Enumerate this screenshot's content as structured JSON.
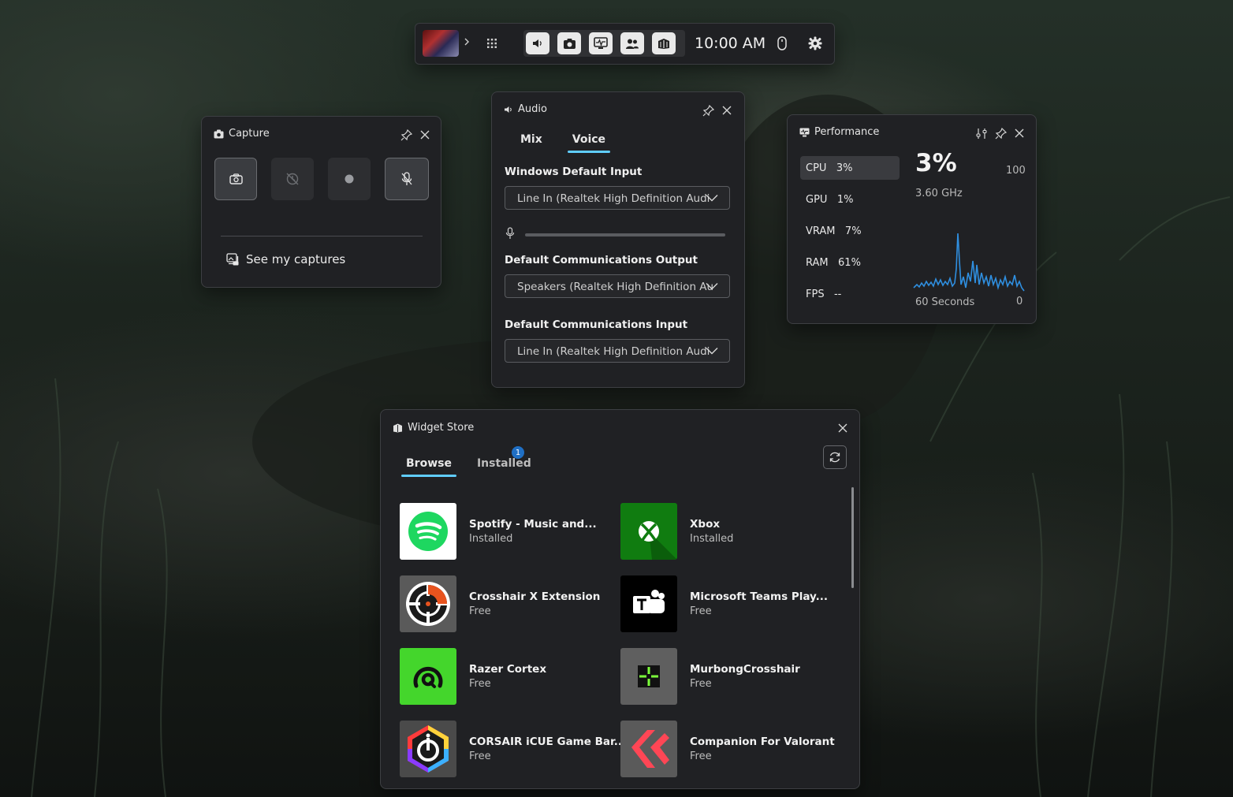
{
  "topbar": {
    "time": "10:00 AM",
    "buttons": [
      "audio-icon",
      "camera-icon",
      "performance-icon",
      "social-icon",
      "widget-store-icon"
    ]
  },
  "capture": {
    "title": "Capture",
    "see_captures": "See my captures"
  },
  "audio": {
    "title": "Audio",
    "tabs": [
      "Mix",
      "Voice"
    ],
    "selected_tab": "Voice",
    "windows_default_input_label": "Windows Default Input",
    "windows_default_input_value": "Line In (Realtek High Definition Audi",
    "comm_output_label": "Default Communications Output",
    "comm_output_value": "Speakers (Realtek High Definition Au",
    "comm_input_label": "Default Communications Input",
    "comm_input_value": "Line In (Realtek High Definition Audi"
  },
  "performance": {
    "title": "Performance",
    "stats": [
      {
        "name": "CPU",
        "value": "3%"
      },
      {
        "name": "GPU",
        "value": "1%"
      },
      {
        "name": "VRAM",
        "value": "7%"
      },
      {
        "name": "RAM",
        "value": "61%"
      },
      {
        "name": "FPS",
        "value": "--"
      }
    ],
    "big_value": "3%",
    "freq": "3.60 GHz",
    "max_label": "100",
    "min_label": "0",
    "time_window": "60 Seconds",
    "accent": "#2f8fe0"
  },
  "store": {
    "title": "Widget Store",
    "tabs": [
      "Browse",
      "Installed"
    ],
    "installed_badge": "1",
    "items": [
      {
        "name": "Spotify - Music and...",
        "status": "Installed"
      },
      {
        "name": "Xbox",
        "status": "Installed"
      },
      {
        "name": "Crosshair X Extension",
        "status": "Free"
      },
      {
        "name": "Microsoft Teams Play...",
        "status": "Free"
      },
      {
        "name": "Razer Cortex",
        "status": "Free"
      },
      {
        "name": "MurbongCrosshair",
        "status": "Free"
      },
      {
        "name": "CORSAIR iCUE Game Bar...",
        "status": "Free"
      },
      {
        "name": "Companion For Valorant",
        "status": "Free"
      }
    ]
  }
}
